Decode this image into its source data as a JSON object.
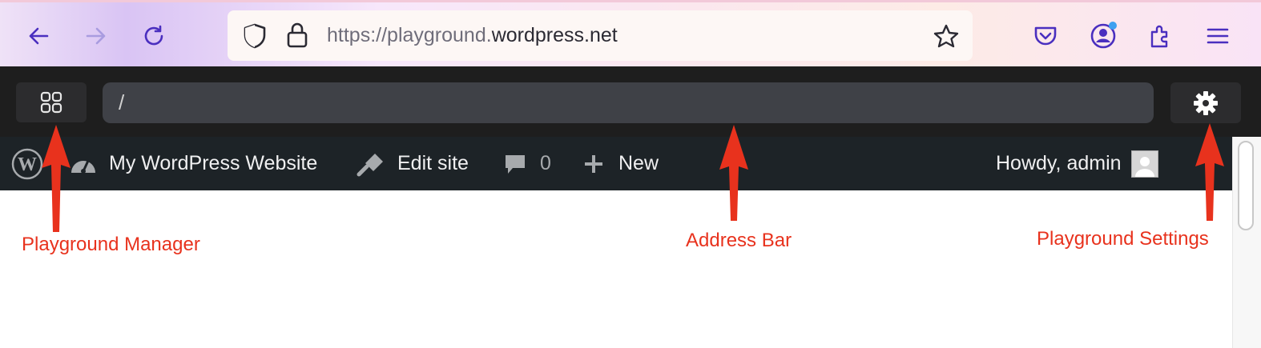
{
  "browser": {
    "url_scheme_host_dim": "https://playground.",
    "url_domain": "wordpress.net",
    "icons": {
      "back": "back-arrow-icon",
      "forward": "forward-arrow-icon",
      "reload": "reload-icon",
      "shield": "shield-icon",
      "lock": "lock-icon",
      "bookmark": "star-icon",
      "pocket": "pocket-icon",
      "account": "account-icon",
      "extensions": "puzzle-icon",
      "menu": "hamburger-menu-icon"
    },
    "accent": "#5b3bd6"
  },
  "playground": {
    "address_value": "/",
    "icons": {
      "manager": "grid-icon",
      "settings": "gear-icon"
    }
  },
  "wp_adminbar": {
    "site_name": "My WordPress Website",
    "edit_site": "Edit site",
    "comments_count": "0",
    "new_label": "New",
    "greeting": "Howdy, admin",
    "background": "#1d2327"
  },
  "annotations": {
    "manager_label": "Playground Manager",
    "address_label": "Address Bar",
    "settings_label": "Playground Settings",
    "color": "#e8321d"
  }
}
